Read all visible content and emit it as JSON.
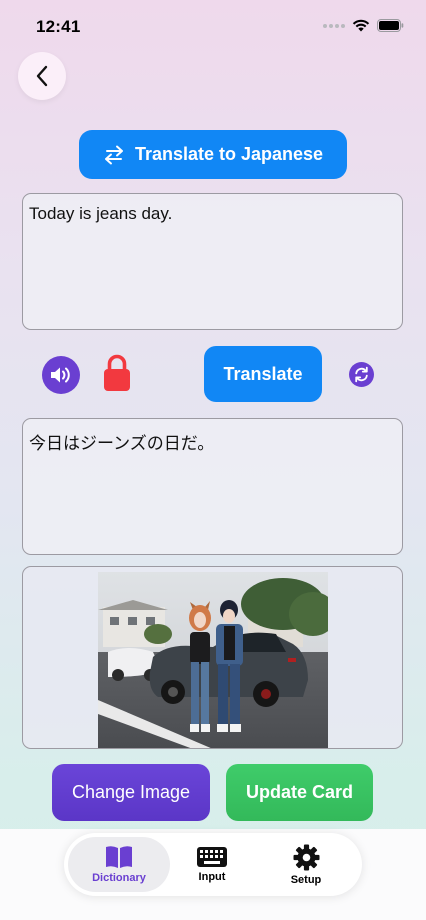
{
  "status_bar": {
    "time": "12:41"
  },
  "header": {
    "translate_to_label": "Translate to Japanese"
  },
  "source_text": "Today is jeans day.",
  "controls": {
    "translate_label": "Translate"
  },
  "translated_text": "今日はジーンズの日だ。",
  "actions": {
    "change_image_label": "Change Image",
    "update_card_label": "Update Card"
  },
  "tab_bar": {
    "items": [
      {
        "label": "Dictionary",
        "icon": "book-icon",
        "active": true
      },
      {
        "label": "Input",
        "icon": "keyboard-icon",
        "active": false
      },
      {
        "label": "Setup",
        "icon": "gear-icon",
        "active": false
      }
    ]
  },
  "colors": {
    "primary_blue": "#1187f5",
    "accent_purple": "#6a3fd1",
    "lock_red": "#f2393f",
    "update_green": "#3fcc6a",
    "active_tab_blue": "#6a3fd1"
  }
}
